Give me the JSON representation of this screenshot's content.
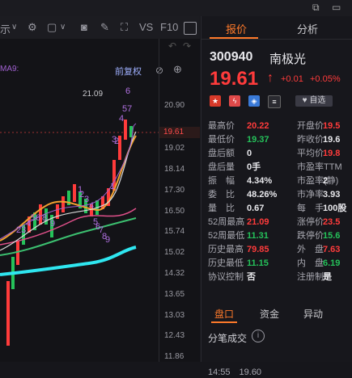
{
  "toolbar": {
    "left_fragment": "示",
    "caret": "∨",
    "vs": "VS",
    "f10": "F10"
  },
  "chart": {
    "ma_label": "MA9:",
    "adjust_label": "前复权",
    "prev_high_label": "21.09",
    "current_price_marker": "19.61",
    "ticks": [
      "20.90",
      "19.61",
      "19.02",
      "18.14",
      "17.30",
      "16.50",
      "15.74",
      "15.02",
      "14.32",
      "13.65",
      "13.03",
      "12.43",
      "11.86"
    ],
    "annotations": [
      "6",
      "57",
      "4",
      "2",
      "3",
      "1",
      "23",
      "4",
      "56",
      "8",
      "9",
      "1",
      "2",
      "3",
      "4",
      "5",
      "6",
      "7",
      "8",
      "9"
    ],
    "colors": {
      "ma_orange": "#f0a030",
      "ma_pink": "#e0508a",
      "ma_green": "#3cc070",
      "ma_cyan": "#2fe6f0",
      "ma_purple": "#a060d0",
      "ma_white": "#d8d8d8",
      "up": "#ff3b3b",
      "down": "#25c25a"
    }
  },
  "right": {
    "tabs": [
      "报价",
      "分析"
    ],
    "code": "300940",
    "name": "南极光",
    "price": "19.61",
    "arrow": "↑",
    "change": "+0.01",
    "change_pct": "+0.05%",
    "self_select": "自选",
    "left_col": [
      {
        "label": "最高价",
        "value": "20.22",
        "tone": "red"
      },
      {
        "label": "最低价",
        "value": "19.37",
        "tone": "green"
      },
      {
        "label": "盘后额",
        "value": "0",
        "tone": "white"
      },
      {
        "label": "盘后量",
        "value": "0手",
        "tone": "white"
      },
      {
        "label": "振　幅",
        "value": "4.34%",
        "tone": "white"
      },
      {
        "label": "委　比",
        "value": "48.26%",
        "tone": "white"
      },
      {
        "label": "量　比",
        "value": "0.67",
        "tone": "white"
      },
      {
        "label": "52周最高",
        "value": "21.09",
        "tone": "red"
      },
      {
        "label": "52周最低",
        "value": "11.31",
        "tone": "green"
      },
      {
        "label": "历史最高",
        "value": "79.85",
        "tone": "red"
      },
      {
        "label": "历史最低",
        "value": "11.15",
        "tone": "green"
      },
      {
        "label": "协议控制",
        "value": "否",
        "tone": "white"
      }
    ],
    "right_col": [
      {
        "label": "开盘价",
        "value": "19.5",
        "tone": "red"
      },
      {
        "label": "昨收价",
        "value": "19.6",
        "tone": "white"
      },
      {
        "label": "平均价",
        "value": "19.8",
        "tone": "red"
      },
      {
        "label": "市盈率TTM",
        "value": "",
        "tone": "white"
      },
      {
        "label": "市盈率(静)",
        "value": "2",
        "tone": "white"
      },
      {
        "label": "市净率",
        "value": "3.93",
        "tone": "white"
      },
      {
        "label": "每　手",
        "value": "100股",
        "tone": "white"
      },
      {
        "label": "涨停价",
        "value": "23.5",
        "tone": "red"
      },
      {
        "label": "跌停价",
        "value": "15.6",
        "tone": "green"
      },
      {
        "label": "外　盘",
        "value": "7.63",
        "tone": "red"
      },
      {
        "label": "内　盘",
        "value": "6.19",
        "tone": "green"
      },
      {
        "label": "注册制",
        "value": "是",
        "tone": "white"
      }
    ],
    "bottom_tabs": [
      "盘口",
      "资金",
      "异动"
    ],
    "fenbi": "分笔成交",
    "last_row": "14:55　19.60"
  }
}
